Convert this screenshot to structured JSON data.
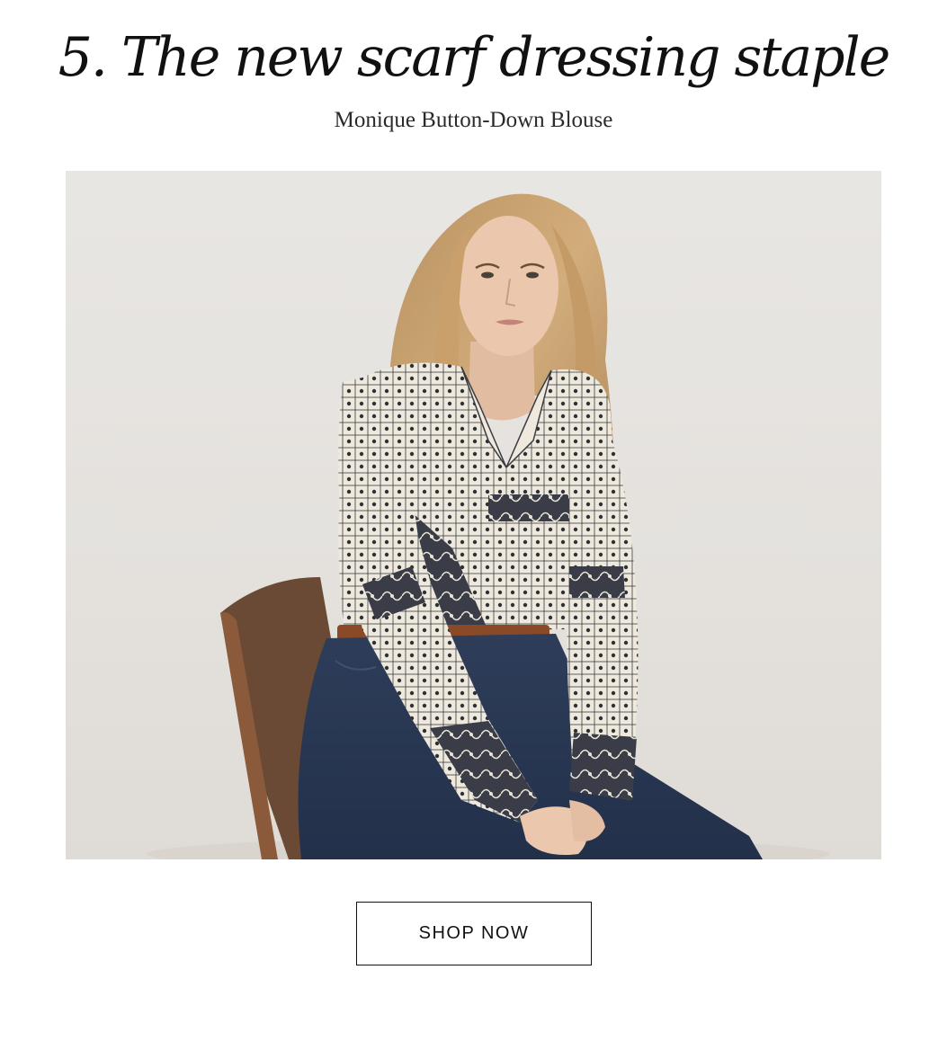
{
  "section": {
    "headline": "5. The new scarf dressing staple",
    "subtitle": "Monique Button-Down Blouse"
  },
  "hero_image": {
    "subject": "model-in-scarf-print-blouse-and-jeans-on-chair",
    "colors": {
      "backdrop": "#e6e3df",
      "hair": "#c9a06b",
      "skin": "#e8c4aa",
      "blouse_base": "#efe9dd",
      "blouse_print": "#2f3138",
      "denim": "#2b3a55",
      "belt": "#8a4a28",
      "chair": "#6a4a34"
    }
  },
  "cta": {
    "label": "SHOP NOW"
  }
}
